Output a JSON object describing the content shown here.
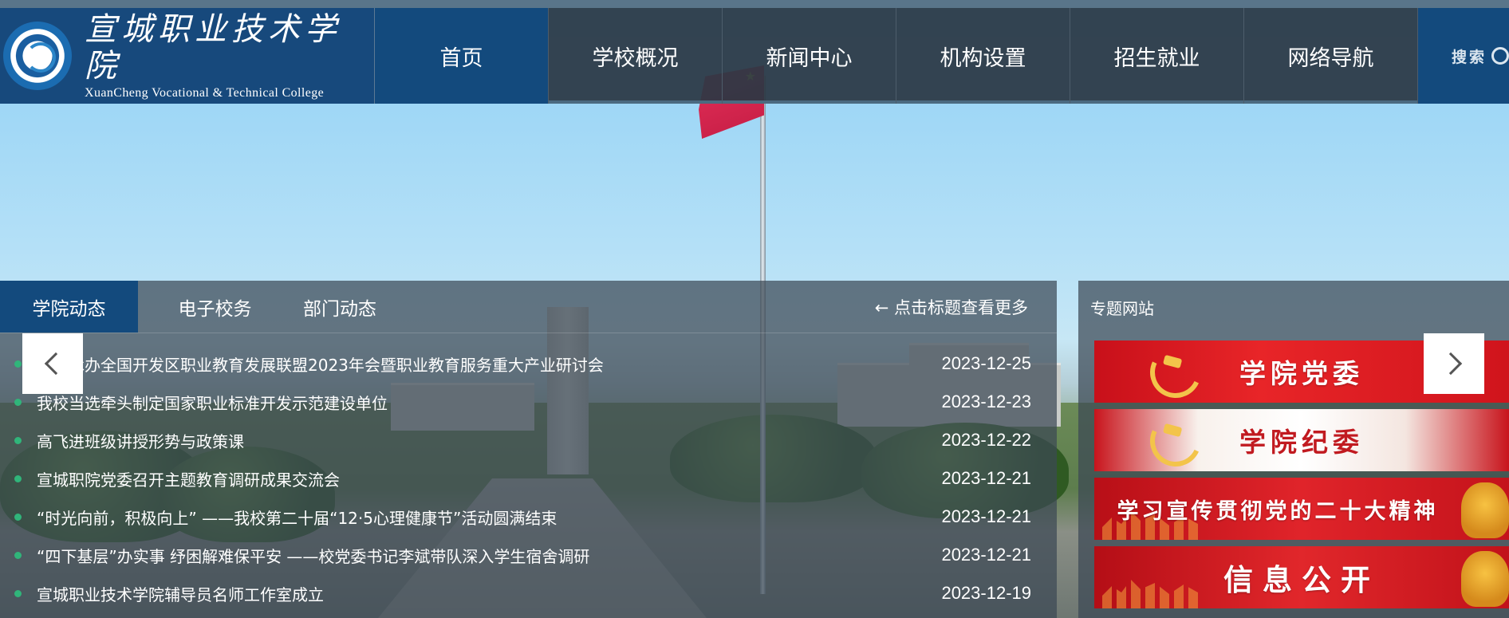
{
  "header": {
    "logo_cn": "宣城职业技术学院",
    "logo_en": "XuanCheng Vocational & Technical College",
    "nav": [
      {
        "label": "首页",
        "active": true
      },
      {
        "label": "学校概况"
      },
      {
        "label": "新闻中心"
      },
      {
        "label": "机构设置"
      },
      {
        "label": "招生就业"
      },
      {
        "label": "网络导航"
      }
    ],
    "search_label": "搜索"
  },
  "news": {
    "tabs": [
      "学院动态",
      "电子校务",
      "部门动态"
    ],
    "more_hint": "← 点击标题查看更多",
    "items": [
      {
        "title": "我校承办全国开发区职业教育发展联盟2023年会暨职业教育服务重大产业研讨会",
        "date": "2023-12-25"
      },
      {
        "title": "我校当选牵头制定国家职业标准开发示范建设单位",
        "date": "2023-12-23"
      },
      {
        "title": "高飞进班级讲授形势与政策课",
        "date": "2023-12-22"
      },
      {
        "title": "宣城职院党委召开主题教育调研成果交流会",
        "date": "2023-12-21"
      },
      {
        "title": "“时光向前，积极向上” ——我校第二十届“12·5心理健康节”活动圆满结束",
        "date": "2023-12-21"
      },
      {
        "title": "“四下基层”办实事 纾困解难保平安 ——校党委书记李斌带队深入学生宿舍调研",
        "date": "2023-12-21"
      },
      {
        "title": "宣城职业技术学院辅导员名师工作室成立",
        "date": "2023-12-19"
      }
    ]
  },
  "topics": {
    "title": "专题网站",
    "banners": [
      "学院党委",
      "学院纪委",
      "学习宣传贯彻党的二十大精神",
      "信息公开"
    ]
  },
  "colors": {
    "primary_blue": "#134a7d",
    "nav_dark": "#2b3844",
    "bullet_green": "#30b57a",
    "banner_red": "#d0141c"
  }
}
